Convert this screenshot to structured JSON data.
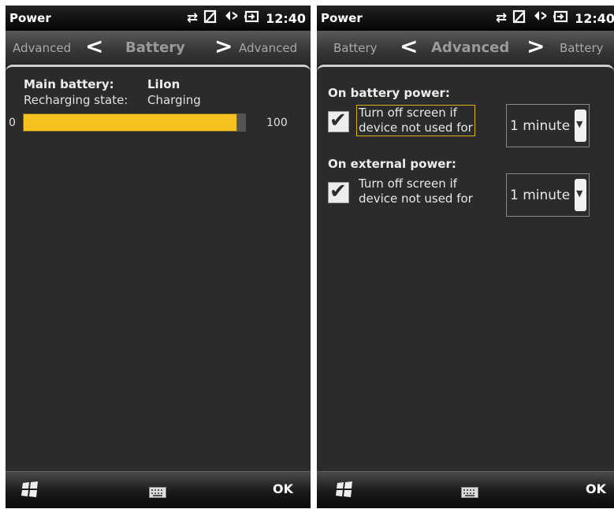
{
  "left": {
    "status": {
      "app_title": "Power",
      "clock": "12:40"
    },
    "tabs": {
      "prev": "Advanced",
      "current": "Battery",
      "next": "Advanced"
    },
    "battery": {
      "main_label": "Main battery:",
      "main_value": "LiIon",
      "state_label": "Recharging state:",
      "state_value": "Charging",
      "scale_min": "0",
      "scale_max": "100",
      "charge_percent": 96
    },
    "softkeys": {
      "ok": "OK"
    }
  },
  "right": {
    "status": {
      "app_title": "Power",
      "clock": "12:40"
    },
    "tabs": {
      "prev": "Battery",
      "current": "Advanced",
      "next": "Battery"
    },
    "battery_section": {
      "heading": "On battery power:",
      "checked": true,
      "option_line1": "Turn off screen if",
      "option_line2": "device not used for",
      "timeout": "1 minute"
    },
    "external_section": {
      "heading": "On external power:",
      "checked": true,
      "option_line1": "Turn off screen if",
      "option_line2": "device not used for",
      "timeout": "1 minute"
    },
    "softkeys": {
      "ok": "OK"
    }
  },
  "icons": [
    "sync-icon",
    "no-sim-icon",
    "volume-muted-icon",
    "battery-charging-icon",
    "windows-start-icon",
    "keyboard-icon",
    "chevron-left-icon",
    "chevron-right-icon",
    "checkmark-icon",
    "dropdown-arrow-icon"
  ],
  "colors": {
    "accent": "#f7c21f",
    "background": "#2b2b2b",
    "focus_border": "#d9b21c"
  }
}
